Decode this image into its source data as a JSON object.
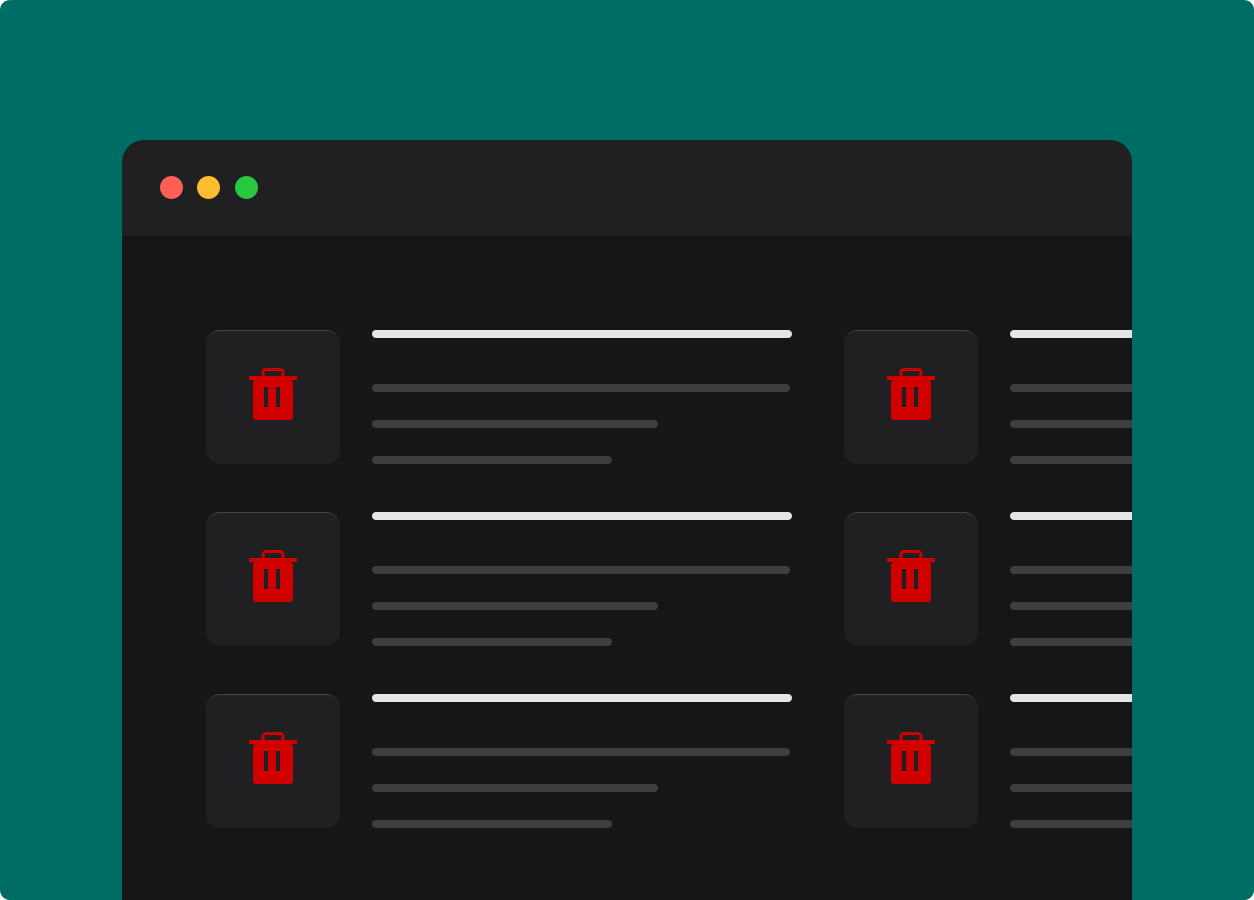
{
  "colors": {
    "backdrop": "#006d65",
    "titlebar": "#202022",
    "content": "#161616",
    "tile": "#202022",
    "trash": "#d00000",
    "title_line": "#e5e5e5",
    "body_line": "#3e3e40",
    "close": "#ff5f57",
    "minimize": "#febc2e",
    "zoom": "#28c840"
  },
  "window": {
    "controls": [
      "close",
      "minimize",
      "zoom"
    ]
  },
  "items": [
    {
      "icon": "trash-icon"
    },
    {
      "icon": "trash-icon"
    },
    {
      "icon": "trash-icon"
    },
    {
      "icon": "trash-icon"
    },
    {
      "icon": "trash-icon"
    },
    {
      "icon": "trash-icon"
    }
  ]
}
